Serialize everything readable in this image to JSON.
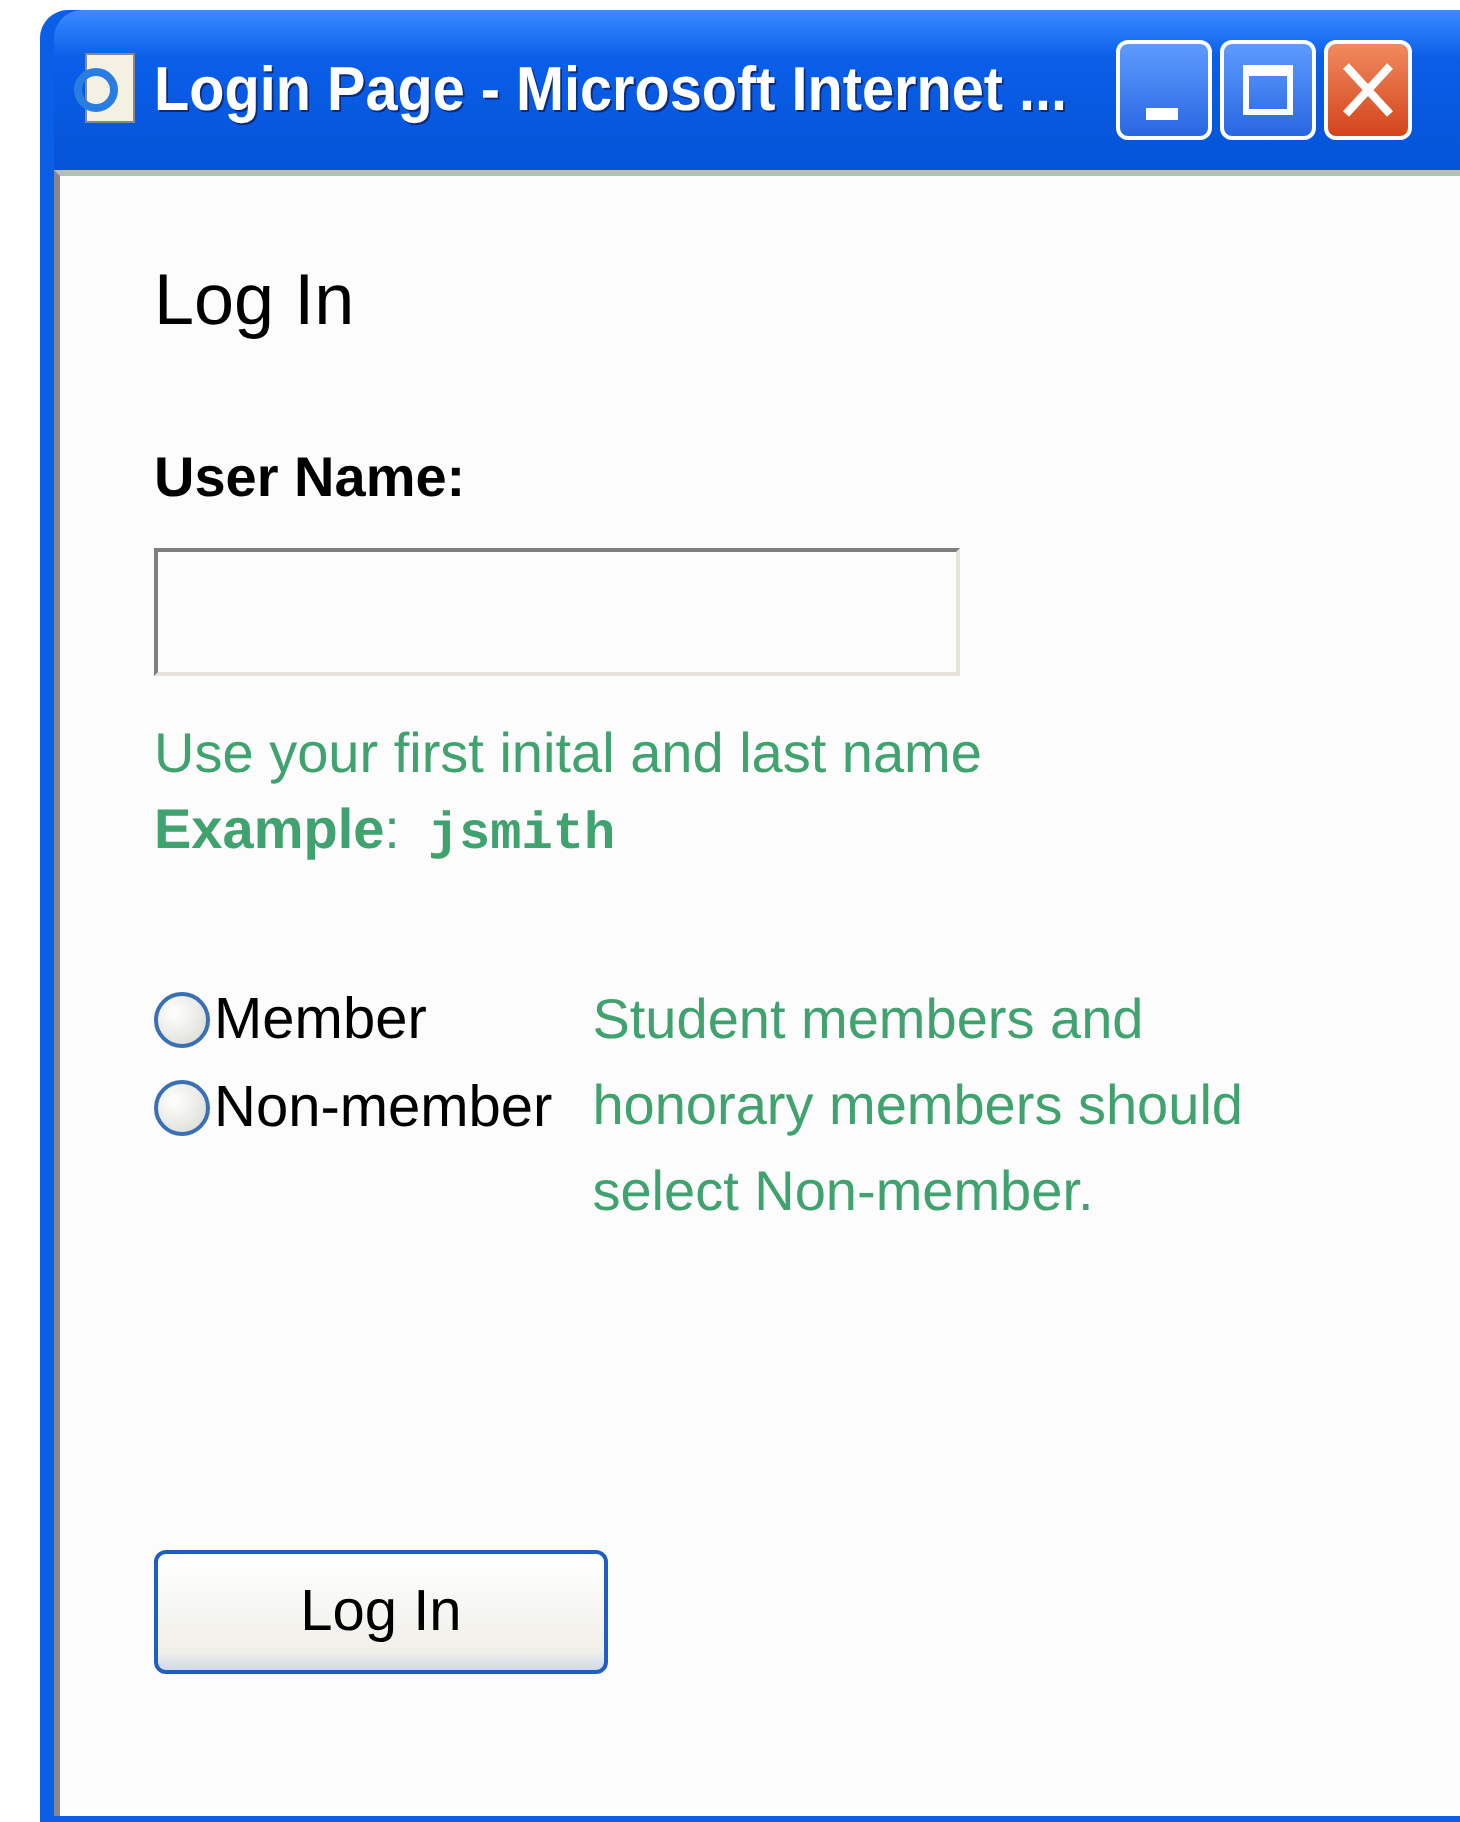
{
  "window": {
    "title": "Login Page - Microsoft Internet ..."
  },
  "heading": "Log In",
  "user_name": {
    "label": "User Name:"
  },
  "hint": "Use your first inital and last name",
  "example": {
    "label": "**Example**:",
    "value": "jsmith"
  },
  "membership": [
    {
      "label": "Member",
      "selected": false
    },
    {
      "label": "Non-member",
      "selected": false
    }
  ],
  "note": "Student members and honorary members should select Non-member.",
  "buttons": [
    "Log In"
  ]
}
